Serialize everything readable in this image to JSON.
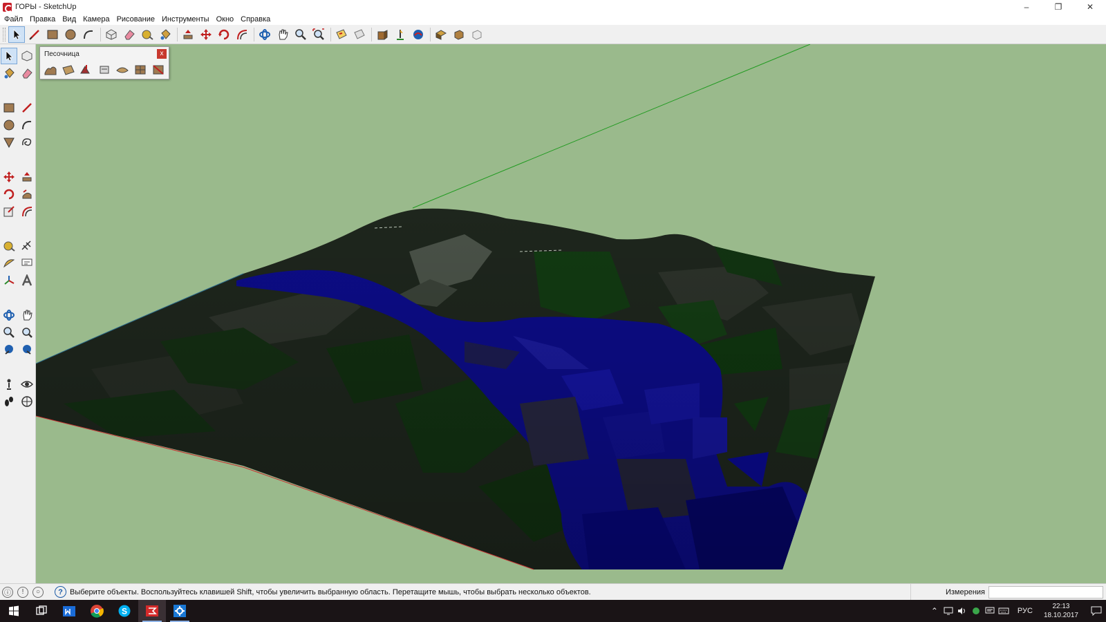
{
  "window": {
    "title": "ГОРЫ - SketchUp",
    "minimize": "–",
    "restore": "❐",
    "close": "✕"
  },
  "menu": [
    "Файл",
    "Правка",
    "Вид",
    "Камера",
    "Рисование",
    "Инструменты",
    "Окно",
    "Справка"
  ],
  "top_toolbar": [
    "select-icon",
    "line-icon",
    "rectangle-icon",
    "circle-icon",
    "arc-icon",
    "make-component-icon",
    "eraser-icon",
    "tape-measure-icon",
    "paint-bucket-icon",
    "push-pull-icon",
    "move-icon",
    "rotate-icon",
    "offset-icon",
    "orbit-icon",
    "pan-icon",
    "zoom-icon",
    "zoom-extents-icon",
    "section-plane-icon",
    "section-display-icon",
    "warehouse-icon",
    "share-model-icon",
    "extension-warehouse-icon",
    "layout-icon",
    "style-builder-icon",
    "preview-icon"
  ],
  "left_toolbar": [
    "select-icon",
    "make-component-icon",
    "paint-bucket-icon",
    "eraser-icon",
    "rectangle-icon",
    "line-icon",
    "circle-icon",
    "arc-icon",
    "polygon-icon",
    "freehand-icon",
    "move-icon",
    "push-pull-icon",
    "rotate-icon",
    "follow-me-icon",
    "scale-icon",
    "offset-icon",
    "tape-measure-icon",
    "dimension-icon",
    "protractor-icon",
    "text-icon",
    "axes-icon",
    "3d-text-icon",
    "orbit-icon",
    "pan-icon",
    "zoom-icon",
    "zoom-extents-icon",
    "previous-view-icon",
    "next-view-icon",
    "position-camera-icon",
    "look-around-icon",
    "walk-icon",
    "section-plane-icon"
  ],
  "sandbox": {
    "title": "Песочница",
    "close": "x",
    "tools": [
      "from-contours-icon",
      "from-scratch-icon",
      "smoove-icon",
      "stamp-icon",
      "drape-icon",
      "add-detail-icon",
      "flip-edge-icon"
    ]
  },
  "status": {
    "text": "Выберите объекты. Воспользуйтесь клавишей Shift, чтобы увеличить выбранную область. Перетащите мышь, чтобы выбрать несколько объектов.",
    "help": "?",
    "measurements_label": "Измерения",
    "measurements_value": ""
  },
  "taskbar": {
    "apps": [
      "start-icon",
      "task-view-icon",
      "store-icon",
      "chrome-icon",
      "skype-icon",
      "sketchup-icon",
      "settings-icon"
    ],
    "language": "РУС",
    "time": "22:13",
    "date": "18.10.2017"
  },
  "colors": {
    "sky": "#9aba8c",
    "terrain_dark": "#1e261d",
    "terrain_green": "#123a12",
    "water": "#0c0c88",
    "axis_red": "#c43030",
    "axis_green": "#1f9a1f"
  }
}
